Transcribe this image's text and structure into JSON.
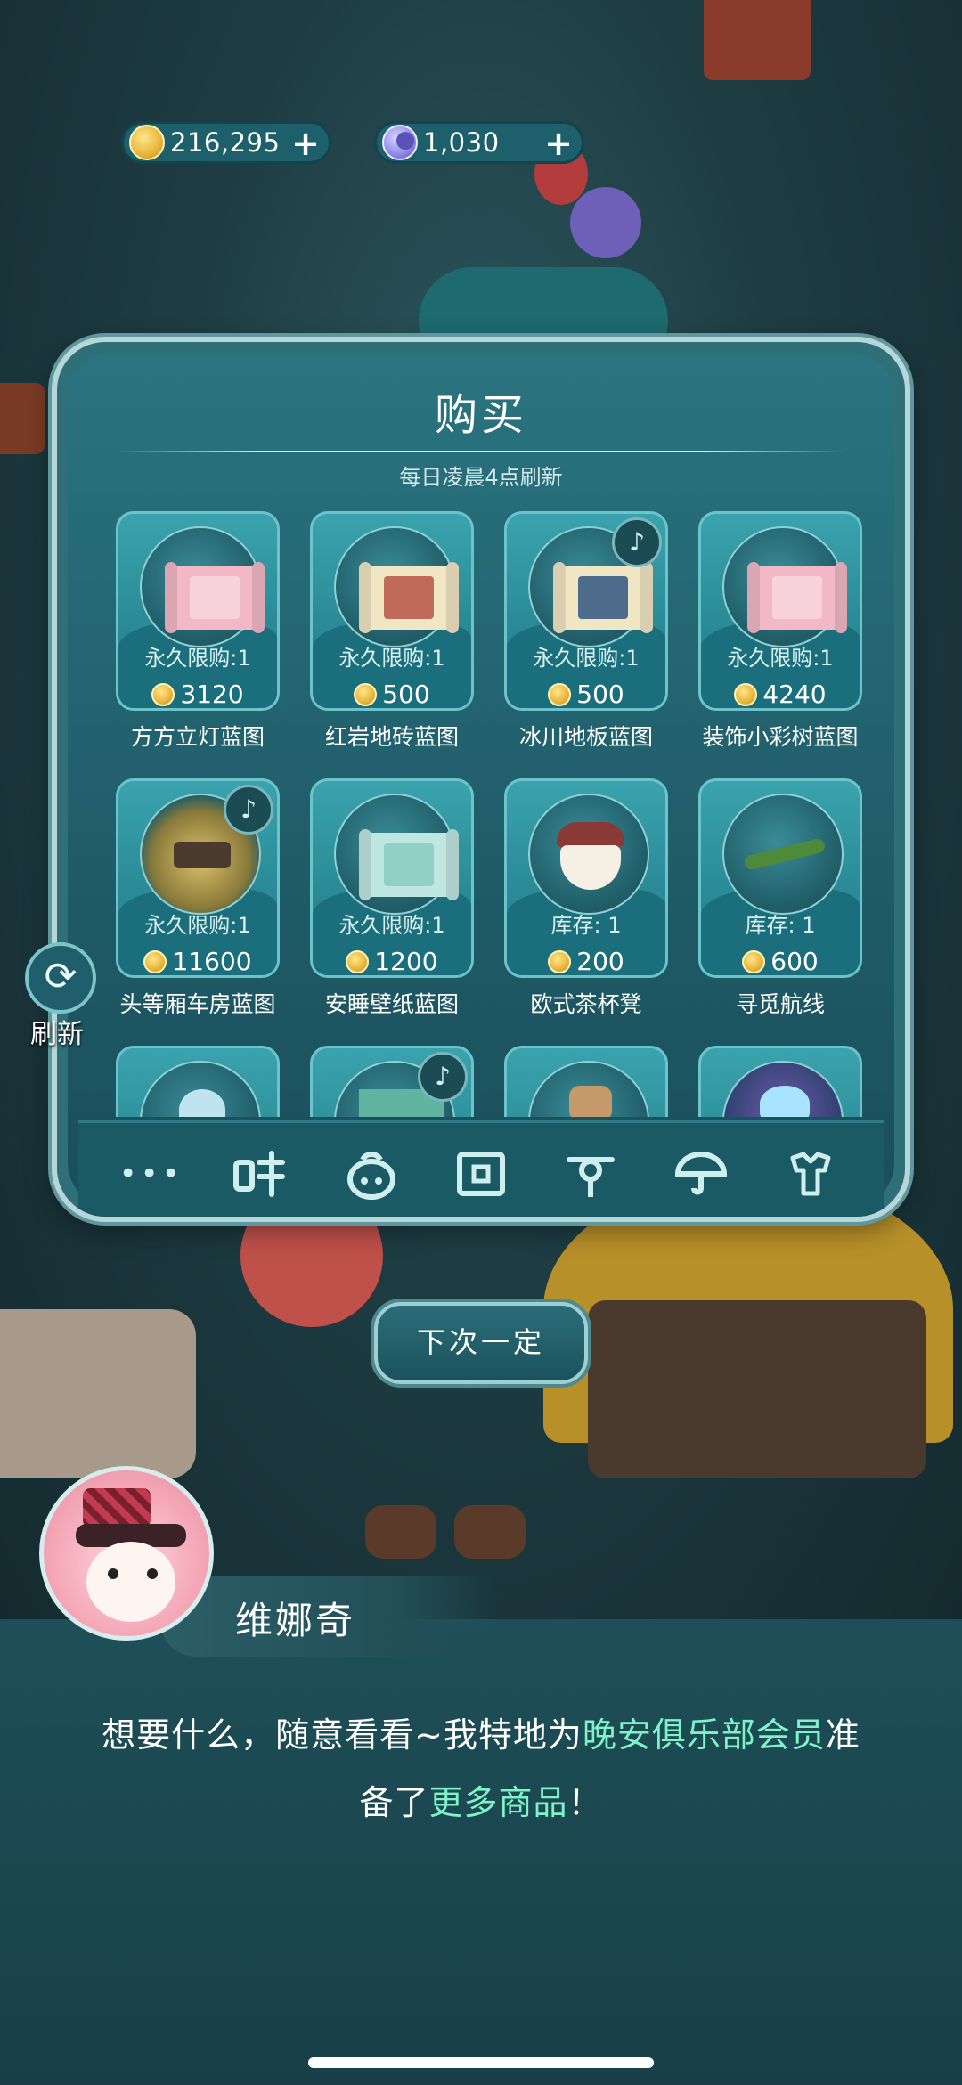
{
  "currency": {
    "coins": "216,295",
    "moons": "1,030",
    "plus": "+"
  },
  "panel": {
    "title": "购买",
    "subtitle": "每日凌晨4点刷新"
  },
  "items": [
    {
      "limit": "永久限购:1",
      "price": "3120",
      "name": "方方立灯蓝图",
      "music": false
    },
    {
      "limit": "永久限购:1",
      "price": "500",
      "name": "红岩地砖蓝图",
      "music": false
    },
    {
      "limit": "永久限购:1",
      "price": "500",
      "name": "冰川地板蓝图",
      "music": true
    },
    {
      "limit": "永久限购:1",
      "price": "4240",
      "name": "装饰小彩树蓝图",
      "music": false
    },
    {
      "limit": "永久限购:1",
      "price": "11600",
      "name": "头等厢车房蓝图",
      "music": true
    },
    {
      "limit": "永久限购:1",
      "price": "1200",
      "name": "安睡壁纸蓝图",
      "music": false
    },
    {
      "limit": "库存: 1",
      "price": "200",
      "name": "欧式茶杯凳",
      "music": false
    },
    {
      "limit": "库存: 1",
      "price": "600",
      "name": "寻觅航线",
      "music": false
    }
  ],
  "tabs": [
    "more-dots-icon",
    "food-icon",
    "bag-icon",
    "blueprint-icon",
    "plant-icon",
    "umbrella-icon",
    "clothes-icon"
  ],
  "refresh_label": "刷新",
  "next_button": "下次一定",
  "dialogue": {
    "speaker": "维娜奇",
    "line1_a": "想要什么，随意看看~我特地为",
    "line1_hl": "晚安俱乐部会员",
    "line1_b": "准",
    "line2_a": "备了",
    "line2_hl": "更多商品",
    "line2_b": "！"
  },
  "colors": {
    "highlight": "#7ff2c7",
    "panel": "#1f5c68",
    "card": "#2a8f9a"
  }
}
